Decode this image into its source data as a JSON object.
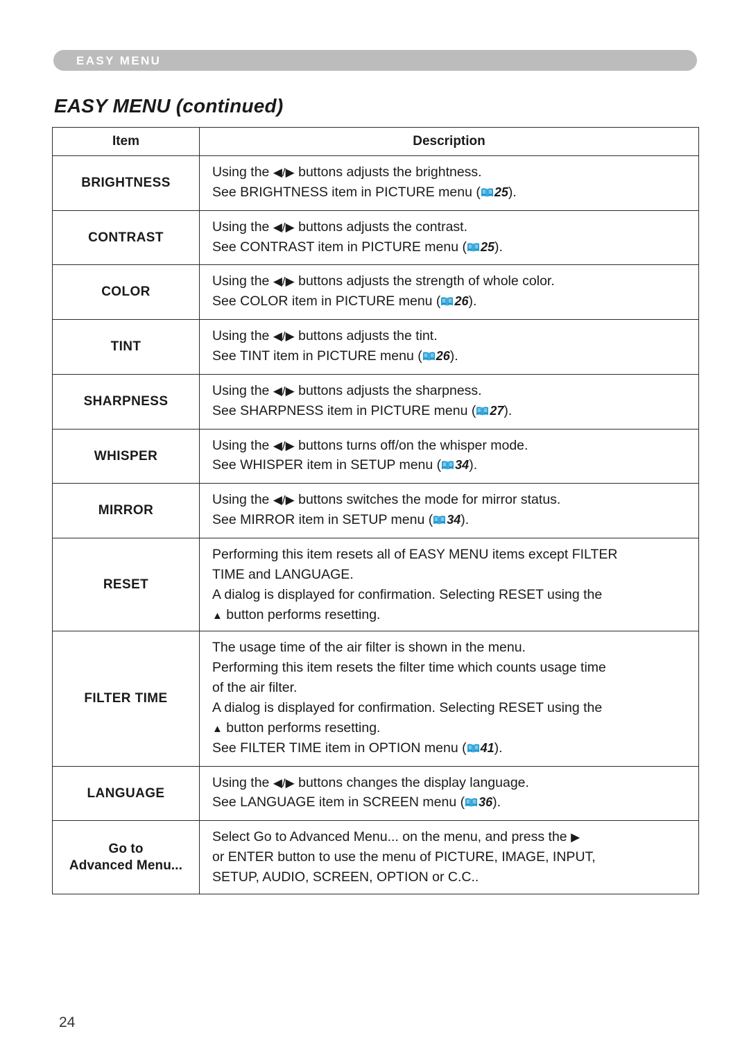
{
  "header": {
    "banner_label": "EASY MENU",
    "page_title": "EASY MENU (continued)"
  },
  "table": {
    "columns": [
      "Item",
      "Description"
    ],
    "rows": [
      {
        "item": "BRIGHTNESS",
        "lines": [
          {
            "text_before": "Using the ",
            "glyph": "left-right-triangles",
            "text_after": " buttons adjusts the brightness."
          },
          {
            "text_before": "See BRIGHTNESS item in PICTURE menu (",
            "book_icon": "book-icon",
            "page_ref": "25",
            "text_after": ")."
          }
        ]
      },
      {
        "item": "CONTRAST",
        "lines": [
          {
            "text_before": "Using the ",
            "glyph": "left-right-triangles",
            "text_after": " buttons adjusts the contrast."
          },
          {
            "text_before": "See CONTRAST item in PICTURE menu (",
            "book_icon": "book-icon",
            "page_ref": "25",
            "text_after": ")."
          }
        ]
      },
      {
        "item": "COLOR",
        "lines": [
          {
            "text_before": "Using the ",
            "glyph": "left-right-triangles",
            "text_after": " buttons adjusts the strength of whole color."
          },
          {
            "text_before": "See COLOR item in PICTURE menu (",
            "book_icon": "book-icon",
            "page_ref": "26",
            "text_after": ")."
          }
        ]
      },
      {
        "item": "TINT",
        "lines": [
          {
            "text_before": "Using the ",
            "glyph": "left-right-triangles",
            "text_after": " buttons adjusts the tint."
          },
          {
            "text_before": "See TINT item in PICTURE menu (",
            "book_icon": "book-icon",
            "page_ref": "26",
            "text_after": ")."
          }
        ]
      },
      {
        "item": "SHARPNESS",
        "lines": [
          {
            "text_before": "Using the ",
            "glyph": "left-right-triangles",
            "text_after": " buttons adjusts the sharpness."
          },
          {
            "text_before": "See SHARPNESS item in PICTURE menu (",
            "book_icon": "book-icon",
            "page_ref": "27",
            "text_after": ")."
          }
        ]
      },
      {
        "item": "WHISPER",
        "lines": [
          {
            "text_before": "Using the ",
            "glyph": "left-right-triangles",
            "text_after": " buttons turns off/on the whisper mode."
          },
          {
            "text_before": "See WHISPER item in SETUP menu (",
            "book_icon": "book-icon",
            "page_ref": "34",
            "text_after": ")."
          }
        ]
      },
      {
        "item": "MIRROR",
        "lines": [
          {
            "text_before": "Using the ",
            "glyph": "left-right-triangles",
            "text_after": " buttons switches the mode for mirror status."
          },
          {
            "text_before": "See MIRROR item in SETUP menu (",
            "book_icon": "book-icon",
            "page_ref": "34",
            "text_after": ")."
          }
        ]
      },
      {
        "item": "RESET",
        "lines": [
          {
            "text_before": "Performing this item resets all of EASY MENU items except FILTER",
            "glyph": null,
            "text_after": ""
          },
          {
            "text_before": "TIME and LANGUAGE.",
            "glyph": null,
            "text_after": ""
          },
          {
            "text_before": "A dialog is displayed for confirmation. Selecting RESET using the",
            "glyph": null,
            "text_after": ""
          },
          {
            "text_before": "",
            "glyph": "up-triangle",
            "text_after": " button performs resetting."
          }
        ]
      },
      {
        "item": "FILTER TIME",
        "lines": [
          {
            "text_before": "The usage time of the air filter is shown in the menu.",
            "glyph": null,
            "text_after": ""
          },
          {
            "text_before": "Performing this item resets the filter time which counts usage time",
            "glyph": null,
            "text_after": ""
          },
          {
            "text_before": "of the air filter.",
            "glyph": null,
            "text_after": ""
          },
          {
            "text_before": "A dialog is displayed for confirmation. Selecting RESET using the",
            "glyph": null,
            "text_after": ""
          },
          {
            "text_before": "",
            "glyph": "up-triangle",
            "text_after": " button performs resetting."
          },
          {
            "text_before": "See FILTER TIME item in OPTION menu (",
            "book_icon": "book-icon",
            "page_ref": "41",
            "text_after": ")."
          }
        ]
      },
      {
        "item": "LANGUAGE",
        "lines": [
          {
            "text_before": "Using the ",
            "glyph": "left-right-triangles",
            "text_after": " buttons changes the display language."
          },
          {
            "text_before": "See LANGUAGE item in SCREEN menu (",
            "book_icon": "book-icon",
            "page_ref": "36",
            "text_after": ")."
          }
        ]
      },
      {
        "item": "Go to\nAdvanced Menu...",
        "item_mixed_case": true,
        "lines": [
          {
            "text_before": "Select Go to Advanced Menu... on the menu, and press the ",
            "glyph": "right-triangle",
            "text_after": ""
          },
          {
            "text_before": "or ENTER button to use the menu of PICTURE, IMAGE, INPUT,",
            "glyph": null,
            "text_after": ""
          },
          {
            "text_before": "SETUP, AUDIO, SCREEN, OPTION or C.C..",
            "glyph": null,
            "text_after": ""
          }
        ]
      }
    ]
  },
  "folio": {
    "page_number": "24"
  },
  "colors": {
    "banner_gray": "#bcbcbc",
    "book_icon_blue": "#1b9ad4",
    "text_black": "#1a1a1a",
    "rule_black": "#2b2b2b"
  },
  "glyphs": {
    "left-right-triangles": "◀/▶",
    "right-triangle": "▶",
    "up-triangle": "▲"
  }
}
